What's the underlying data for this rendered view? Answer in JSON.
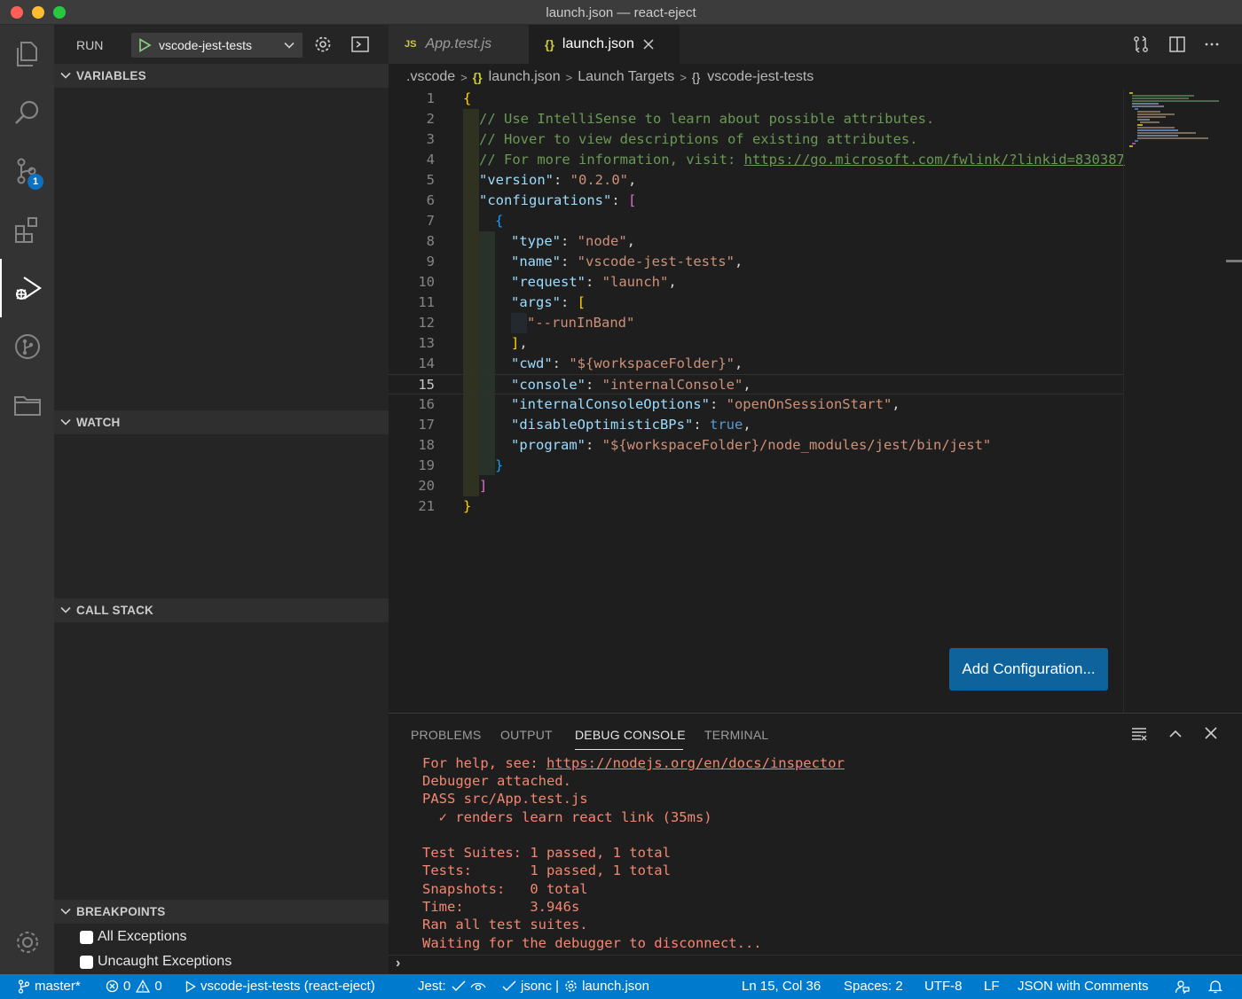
{
  "window": {
    "title": "launch.json — react-eject"
  },
  "activity_bar": {
    "items": [
      {
        "icon": "files-icon"
      },
      {
        "icon": "search-icon"
      },
      {
        "icon": "source-control-icon",
        "badge": "1"
      },
      {
        "icon": "extensions-icon"
      },
      {
        "icon": "run-debug-icon",
        "active": true
      },
      {
        "icon": "git-graph-icon"
      },
      {
        "icon": "folder-icon"
      }
    ],
    "bottom_icon": "settings-gear-icon"
  },
  "sidebar": {
    "run_label": "RUN",
    "launch_config": "vscode-jest-tests",
    "sections": {
      "variables": "VARIABLES",
      "watch": "WATCH",
      "call_stack": "CALL STACK",
      "breakpoints": "BREAKPOINTS"
    },
    "breakpoints": [
      {
        "label": "All Exceptions",
        "checked": false
      },
      {
        "label": "Uncaught Exceptions",
        "checked": false
      }
    ]
  },
  "editor": {
    "tabs": [
      {
        "icon": "JS",
        "label": "App.test.js",
        "active": false
      },
      {
        "icon": "{}",
        "label": "launch.json",
        "active": true
      }
    ],
    "breadcrumb": [
      ".vscode",
      "launch.json",
      "Launch Targets",
      "vscode-jest-tests"
    ],
    "breadcrumb_icons": [
      "{}",
      "{}"
    ],
    "line_numbers": [
      "1",
      "2",
      "3",
      "4",
      "5",
      "6",
      "7",
      "8",
      "9",
      "10",
      "11",
      "12",
      "13",
      "14",
      "15",
      "16",
      "17",
      "18",
      "19",
      "20",
      "21"
    ],
    "code": {
      "l1": "{",
      "l2": "// Use IntelliSense to learn about possible attributes.",
      "l3": "// Hover to view descriptions of existing attributes.",
      "l4_comment": "// For more information, visit: ",
      "l4_link": "https://go.microsoft.com/fwlink/?linkid=830387",
      "l5_key": "\"version\"",
      "l5_val": "\"0.2.0\"",
      "l6_key": "\"configurations\"",
      "l6_open": "[",
      "l7": "{",
      "l8_key": "\"type\"",
      "l8_val": "\"node\"",
      "l9_key": "\"name\"",
      "l9_val": "\"vscode-jest-tests\"",
      "l10_key": "\"request\"",
      "l10_val": "\"launch\"",
      "l11_key": "\"args\"",
      "l11_open": "[",
      "l12_val": "\"--runInBand\"",
      "l13": "]",
      "l14_key": "\"cwd\"",
      "l14_val": "\"${workspaceFolder}\"",
      "l15_key": "\"console\"",
      "l15_val": "\"internalConsole\"",
      "l16_key": "\"internalConsoleOptions\"",
      "l16_val": "\"openOnSessionStart\"",
      "l17_key": "\"disableOptimisticBPs\"",
      "l17_val": "true",
      "l18_key": "\"program\"",
      "l18_val": "\"${workspaceFolder}/node_modules/jest/bin/jest\"",
      "l19": "}",
      "l20": "]",
      "l21": "}"
    },
    "add_config_button": "Add Configuration..."
  },
  "panel": {
    "tabs": [
      "PROBLEMS",
      "OUTPUT",
      "DEBUG CONSOLE",
      "TERMINAL"
    ],
    "active_tab": "DEBUG CONSOLE",
    "console": {
      "help_prefix": "For help, see: ",
      "help_link": "https://nodejs.org/en/docs/inspector",
      "lines": [
        "Debugger attached.",
        "PASS src/App.test.js",
        "  ✓ renders learn react link (35ms)",
        "",
        "Test Suites: 1 passed, 1 total",
        "Tests:       1 passed, 1 total",
        "Snapshots:   0 total",
        "Time:        3.946s",
        "Ran all test suites.",
        "Waiting for the debugger to disconnect..."
      ],
      "prompt": "›"
    }
  },
  "status_bar": {
    "branch": "master*",
    "errors": "0",
    "warnings": "0",
    "debug_target": "vscode-jest-tests (react-eject)",
    "jest": "Jest:",
    "jsonc": "jsonc |",
    "file": "launch.json",
    "position": "Ln 15, Col 36",
    "spaces": "Spaces: 2",
    "encoding": "UTF-8",
    "eol": "LF",
    "language": "JSON with Comments"
  },
  "colors": {
    "accent": "#007acc",
    "button": "#0e639c",
    "console_text": "#f48771"
  }
}
